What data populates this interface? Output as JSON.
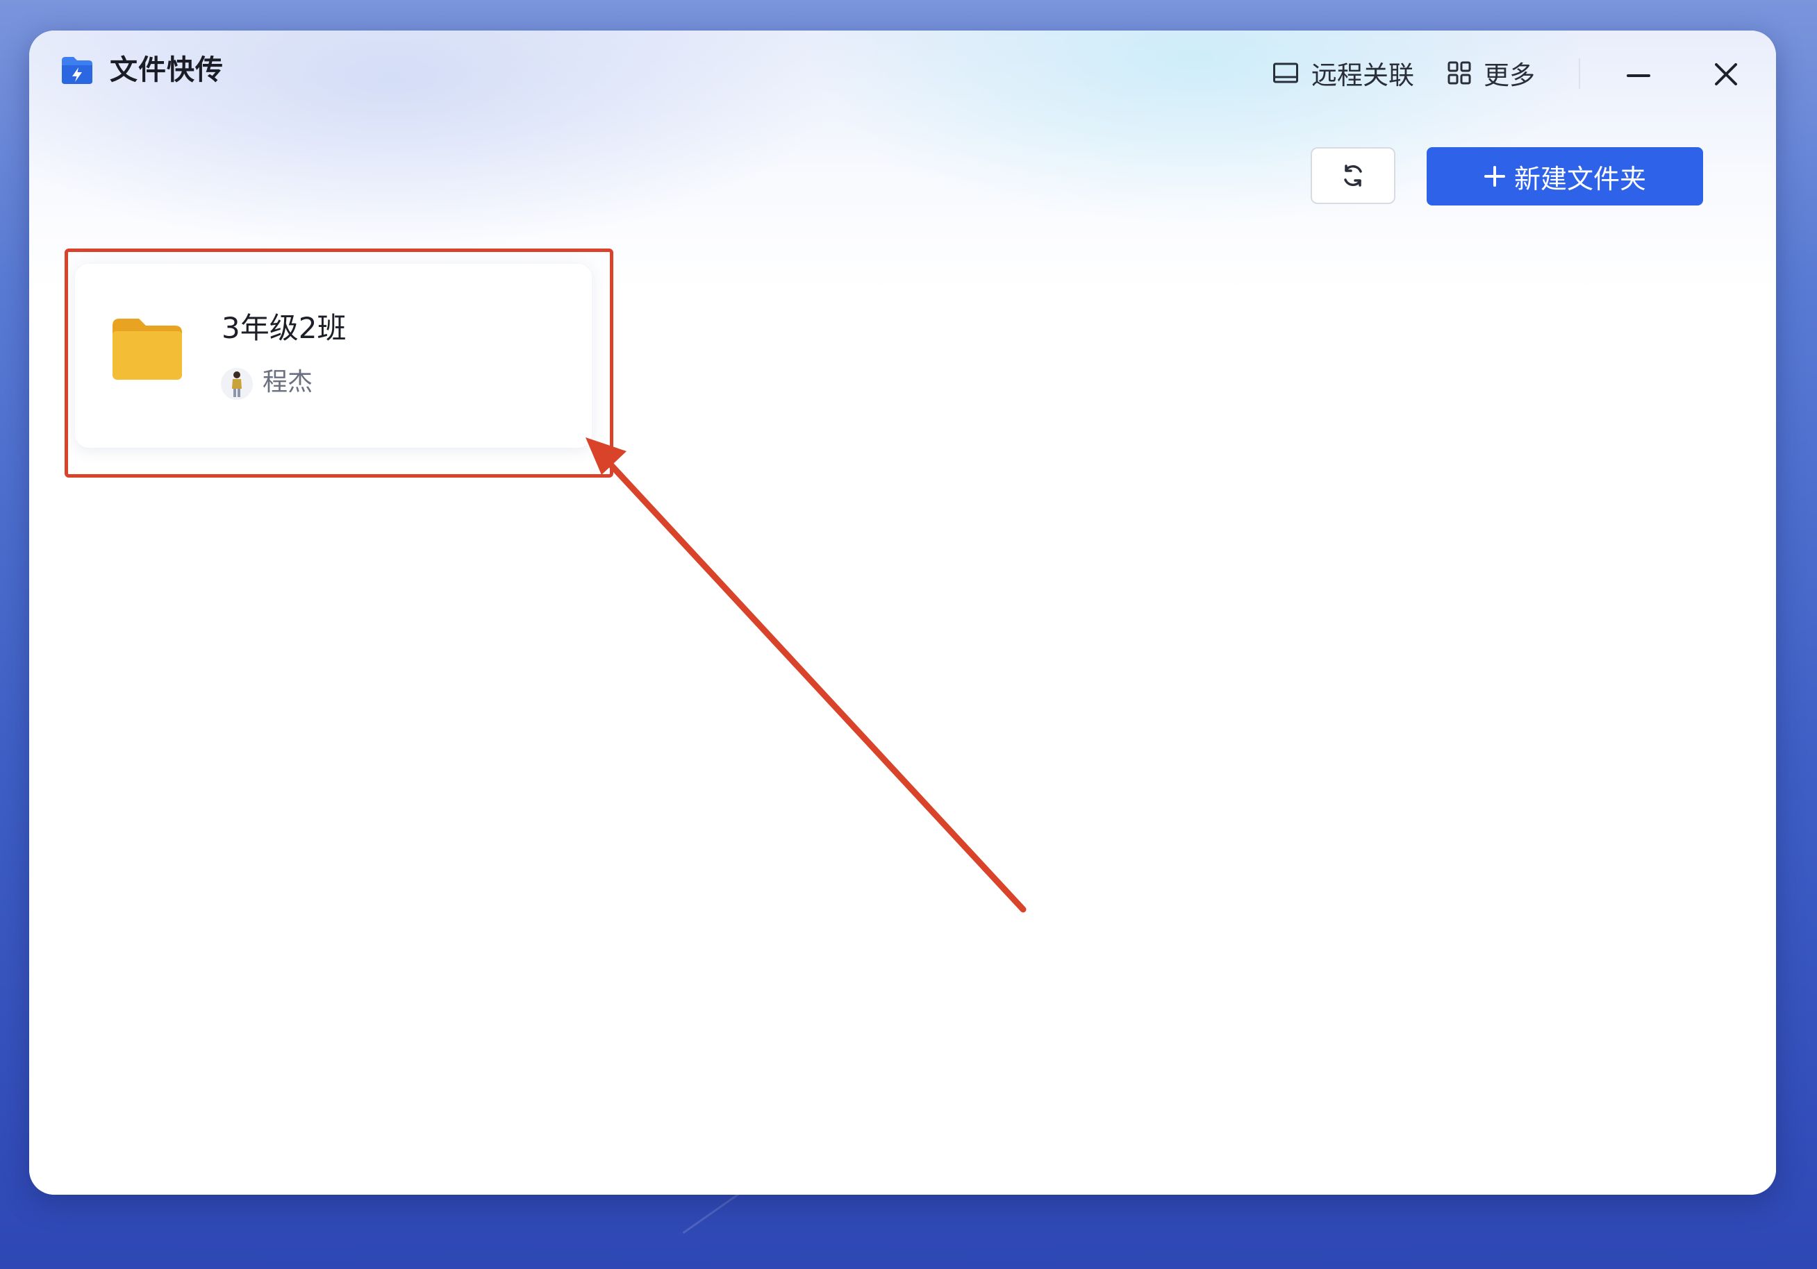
{
  "app": {
    "title": "文件快传"
  },
  "titlebar": {
    "remote_label": "远程关联",
    "more_label": "更多"
  },
  "toolbar": {
    "new_folder_label": "新建文件夹"
  },
  "folders": [
    {
      "name": "3年级2班",
      "owner": "程杰"
    }
  ],
  "colors": {
    "accent": "#2e63e9",
    "annotation": "#d8432a",
    "folder": "#f3b731"
  },
  "icons": {
    "app": "folder-lightning-icon",
    "remote": "monitor-icon",
    "more": "grid-icon",
    "refresh": "refresh-icon",
    "minimize": "minimize-icon",
    "close": "close-icon"
  }
}
